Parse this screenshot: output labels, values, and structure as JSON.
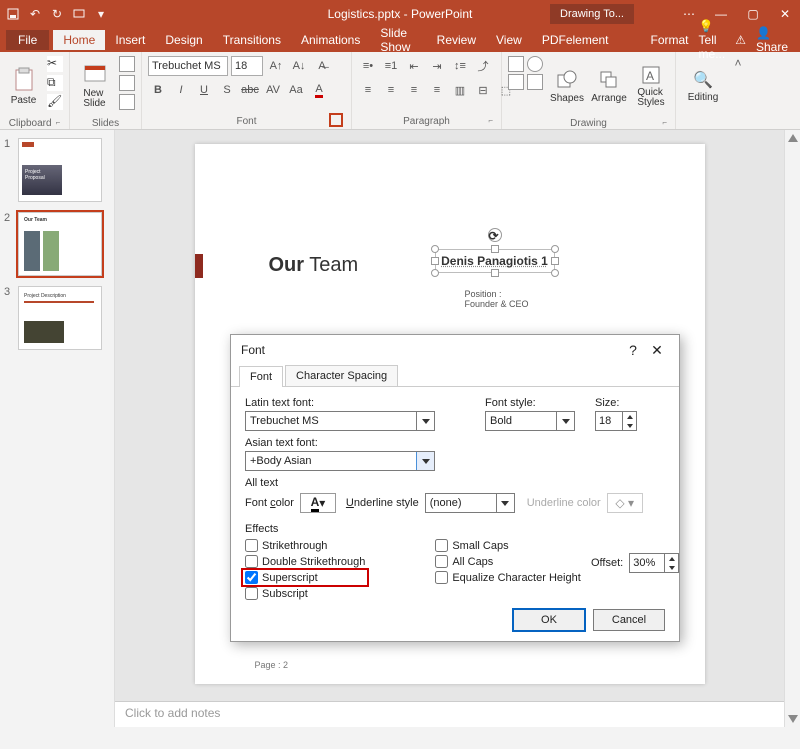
{
  "titlebar": {
    "document_title": "Logistics.pptx - PowerPoint",
    "context_tab": "Drawing To..."
  },
  "window_controls": {
    "ribbon_opts": "⋯",
    "minimize": "—",
    "restore": "▢",
    "close": "✕"
  },
  "ribbon": {
    "tabs": {
      "file": "File",
      "home": "Home",
      "insert": "Insert",
      "design": "Design",
      "transitions": "Transitions",
      "animations": "Animations",
      "slideshow": "Slide Show",
      "review": "Review",
      "view": "View",
      "pdfelement": "PDFelement",
      "format": "Format"
    },
    "right": {
      "tell_me": "Tell me...",
      "share": "Share"
    },
    "groups": {
      "clipboard": {
        "label": "Clipboard",
        "paste": "Paste"
      },
      "slides": {
        "label": "Slides",
        "new_slide": "New\nSlide"
      },
      "font": {
        "label": "Font",
        "name": "Trebuchet MS",
        "size": "18",
        "bold": "B",
        "italic": "I",
        "underline": "U",
        "strike": "S",
        "shadow": "abc",
        "charspacing": "AV",
        "changecase": "Aa"
      },
      "paragraph": {
        "label": "Paragraph"
      },
      "drawing": {
        "label": "Drawing",
        "shapes": "Shapes",
        "arrange": "Arrange",
        "quick_styles": "Quick\nStyles"
      },
      "editing": {
        "label": "Editing"
      }
    }
  },
  "thumbs": {
    "n1": "1",
    "n2": "2",
    "n3": "3"
  },
  "slide": {
    "our": "Our",
    "team": " Team",
    "selected_text": "Denis Panagiotis 1",
    "position_label": "Position  :",
    "position_value": "Founder & CEO",
    "page_footer": "Page : 2"
  },
  "notes": {
    "placeholder": "Click to add notes"
  },
  "dialog": {
    "title": "Font",
    "tab_font": "Font",
    "tab_spacing": "Character Spacing",
    "latin_label": "Latin text font:",
    "latin_value": "Trebuchet MS",
    "style_label": "Font style:",
    "style_value": "Bold",
    "size_label": "Size:",
    "size_value": "18",
    "asian_label": "Asian text font:",
    "asian_value": "+Body Asian",
    "alltext_label": "All text",
    "font_color_label": "Font color",
    "underline_style_label": "Underline style",
    "underline_style_value": "(none)",
    "underline_color_label": "Underline color",
    "effects_label": "Effects",
    "strike": "Strikethrough",
    "dblstrike": "Double Strikethrough",
    "superscript": "Superscript",
    "subscript": "Subscript",
    "smallcaps": "Small Caps",
    "allcaps": "All Caps",
    "eqheight": "Equalize Character Height",
    "offset_label": "Offset:",
    "offset_value": "30%",
    "ok": "OK",
    "cancel": "Cancel",
    "help": "?"
  }
}
